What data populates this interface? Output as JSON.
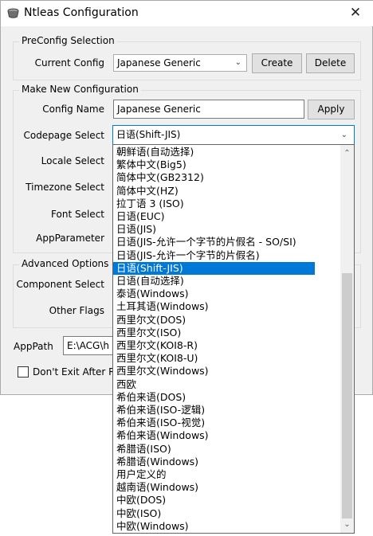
{
  "window": {
    "title": "Ntleas Configuration",
    "close_glyph": "✕"
  },
  "preconfig": {
    "title": "PreConfig Selection",
    "current_config_label": "Current Config",
    "current_config_value": "Japanese Generic",
    "create_label": "Create",
    "delete_label": "Delete"
  },
  "new_config": {
    "title": "Make New Configuration",
    "config_name_label": "Config Name",
    "config_name_value": "Japanese Generic",
    "apply_label": "Apply",
    "codepage_label": "Codepage Select",
    "codepage_value": "日语(Shift-JIS)",
    "locale_label": "Locale Select",
    "timezone_label": "Timezone Select",
    "font_label": "Font Select",
    "appparameter_label": "AppParameter"
  },
  "advanced": {
    "title": "Advanced Options",
    "component_label": "Component Select",
    "other_flags_label": "Other Flags"
  },
  "apppath": {
    "label": "AppPath",
    "value": "E:\\ACG\\h"
  },
  "dont_exit": {
    "label": "Don't Exit After R"
  },
  "codepage_dropdown": {
    "selected_index": 9,
    "scroll_thumb_start": 0.33,
    "scroll_thumb_end": 0.96,
    "options": [
      "朝鲜语(自动选择)",
      "繁体中文(Big5)",
      "简体中文(GB2312)",
      "简体中文(HZ)",
      "拉丁语 3 (ISO)",
      "日语(EUC)",
      "日语(JIS)",
      "日语(JIS-允许一个字节的片假名 - SO/SI)",
      "日语(JIS-允许一个字节的片假名)",
      "日语(Shift-JIS)",
      "日语(自动选择)",
      "泰语(Windows)",
      "土耳其语(Windows)",
      "西里尔文(DOS)",
      "西里尔文(ISO)",
      "西里尔文(KOI8-R)",
      "西里尔文(KOI8-U)",
      "西里尔文(Windows)",
      "西欧",
      "希伯来语(DOS)",
      "希伯来语(ISO-逻辑)",
      "希伯来语(ISO-视觉)",
      "希伯来语(Windows)",
      "希腊语(ISO)",
      "希腊语(Windows)",
      "用户定义的",
      "越南语(Windows)",
      "中欧(DOS)",
      "中欧(ISO)",
      "中欧(Windows)"
    ]
  }
}
